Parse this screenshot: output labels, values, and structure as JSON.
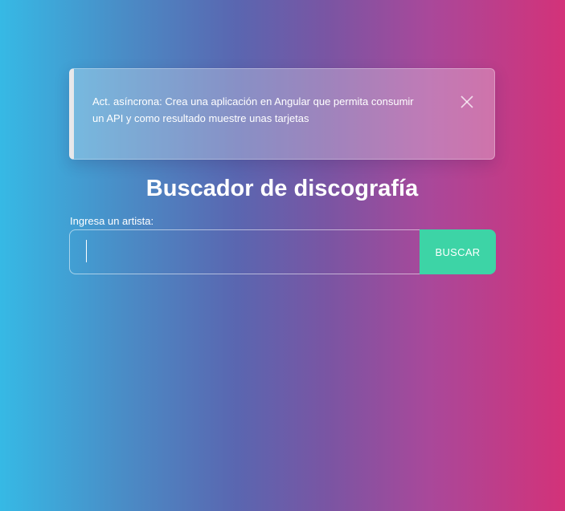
{
  "notice": {
    "text": "Act. asíncrona: Crea una aplicación en Angular que permita consumir un API y como resultado muestre unas tarjetas",
    "close_icon": "close-icon",
    "border_color": "#e8e8ea"
  },
  "header": {
    "title": "Buscador de discografía"
  },
  "search": {
    "label": "Ingresa un artista:",
    "value": "",
    "placeholder": "",
    "button_label": "BUSCAR",
    "button_color": "#3dd4a6"
  },
  "theme": {
    "gradient_start": "#36b9e5",
    "gradient_end": "#d33279"
  }
}
